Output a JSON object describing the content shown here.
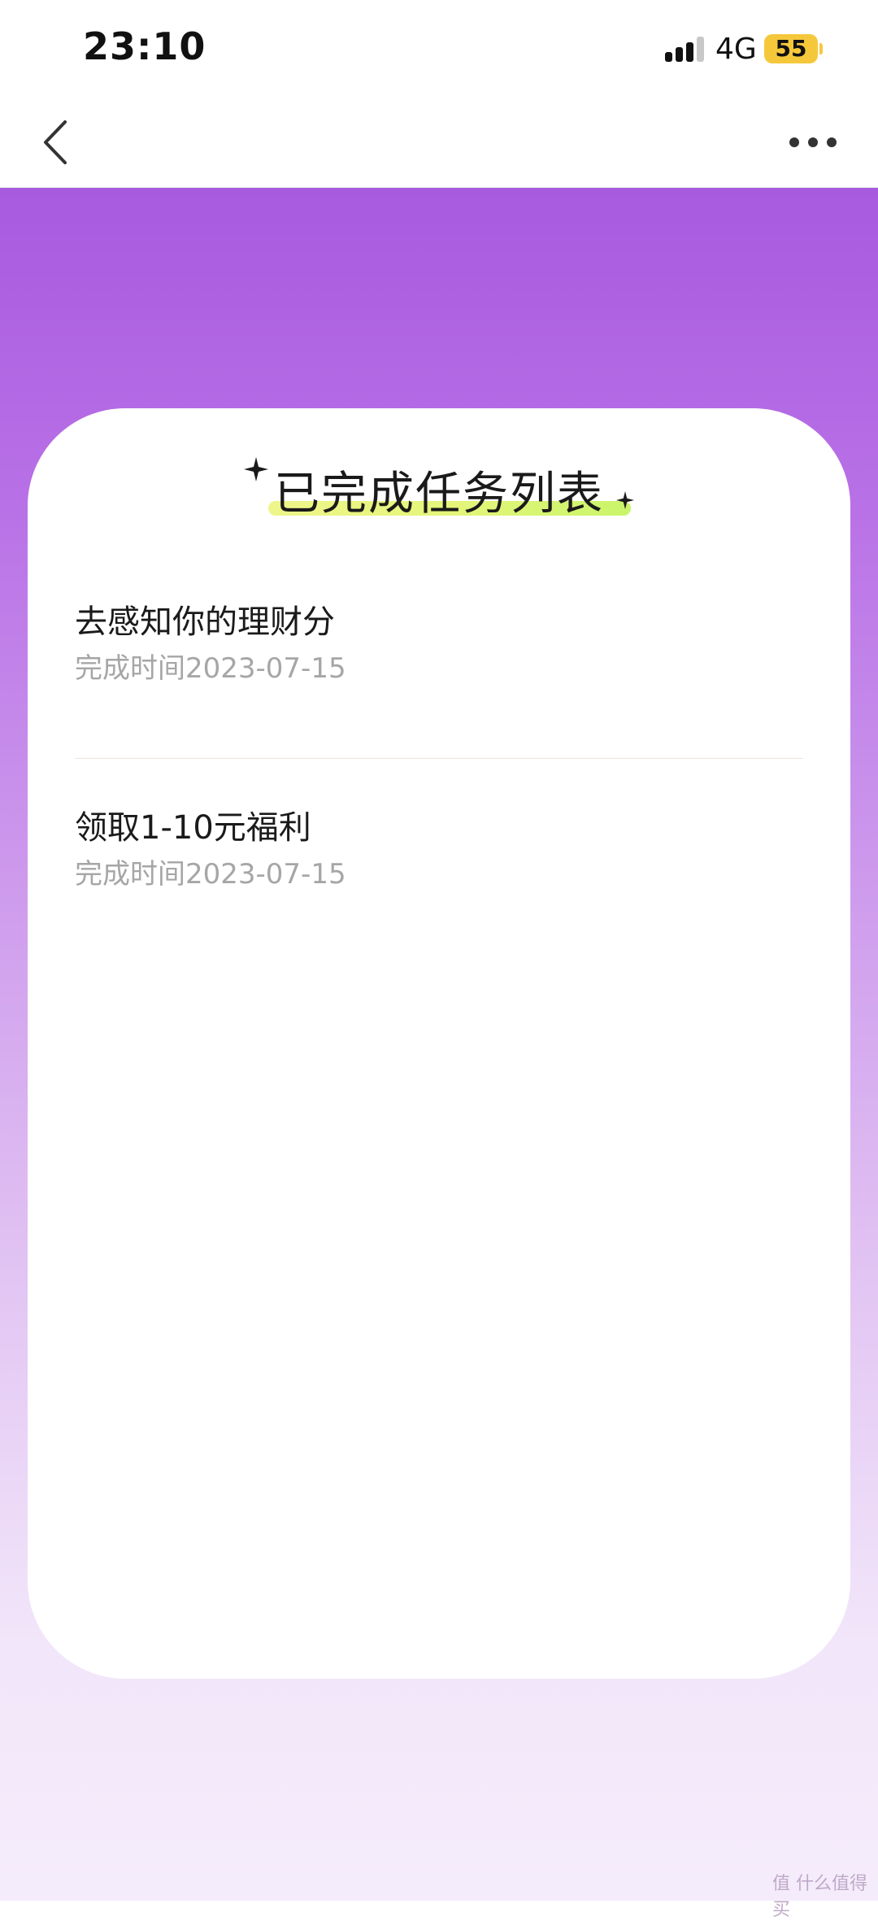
{
  "status_bar": {
    "time": "23:10",
    "network": "4G",
    "battery": "55"
  },
  "nav": {
    "back_icon": "chevron-left-icon",
    "more_icon": "more-horizontal-icon"
  },
  "card": {
    "title": "已完成任务列表",
    "tasks": [
      {
        "name": "去感知你的理财分",
        "time": "完成时间2023-07-15"
      },
      {
        "name": "领取1-10元福利",
        "time": "完成时间2023-07-15"
      }
    ]
  },
  "watermark": "值 什么值得买",
  "colors": {
    "gradient_top": "#a85adf",
    "gradient_bottom": "#f5ecfb",
    "battery": "#f5c83c",
    "highlight": "#e5f57a"
  }
}
